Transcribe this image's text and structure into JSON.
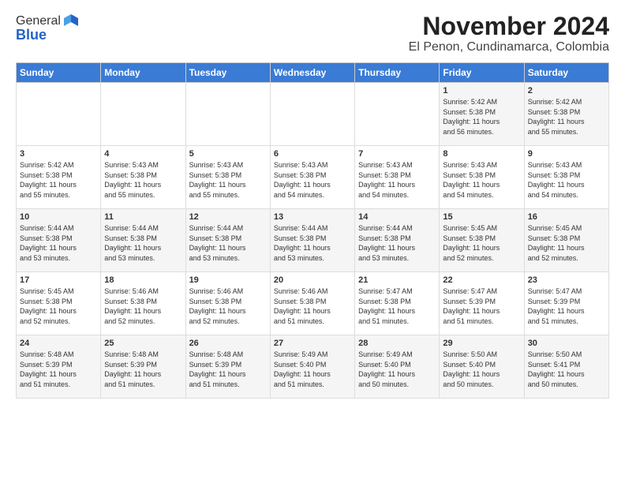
{
  "logo": {
    "general": "General",
    "blue": "Blue"
  },
  "title": "November 2024",
  "subtitle": "El Penon, Cundinamarca, Colombia",
  "headers": [
    "Sunday",
    "Monday",
    "Tuesday",
    "Wednesday",
    "Thursday",
    "Friday",
    "Saturday"
  ],
  "weeks": [
    [
      {
        "day": "",
        "info": ""
      },
      {
        "day": "",
        "info": ""
      },
      {
        "day": "",
        "info": ""
      },
      {
        "day": "",
        "info": ""
      },
      {
        "day": "",
        "info": ""
      },
      {
        "day": "1",
        "info": "Sunrise: 5:42 AM\nSunset: 5:38 PM\nDaylight: 11 hours\nand 56 minutes."
      },
      {
        "day": "2",
        "info": "Sunrise: 5:42 AM\nSunset: 5:38 PM\nDaylight: 11 hours\nand 55 minutes."
      }
    ],
    [
      {
        "day": "3",
        "info": "Sunrise: 5:42 AM\nSunset: 5:38 PM\nDaylight: 11 hours\nand 55 minutes."
      },
      {
        "day": "4",
        "info": "Sunrise: 5:43 AM\nSunset: 5:38 PM\nDaylight: 11 hours\nand 55 minutes."
      },
      {
        "day": "5",
        "info": "Sunrise: 5:43 AM\nSunset: 5:38 PM\nDaylight: 11 hours\nand 55 minutes."
      },
      {
        "day": "6",
        "info": "Sunrise: 5:43 AM\nSunset: 5:38 PM\nDaylight: 11 hours\nand 54 minutes."
      },
      {
        "day": "7",
        "info": "Sunrise: 5:43 AM\nSunset: 5:38 PM\nDaylight: 11 hours\nand 54 minutes."
      },
      {
        "day": "8",
        "info": "Sunrise: 5:43 AM\nSunset: 5:38 PM\nDaylight: 11 hours\nand 54 minutes."
      },
      {
        "day": "9",
        "info": "Sunrise: 5:43 AM\nSunset: 5:38 PM\nDaylight: 11 hours\nand 54 minutes."
      }
    ],
    [
      {
        "day": "10",
        "info": "Sunrise: 5:44 AM\nSunset: 5:38 PM\nDaylight: 11 hours\nand 53 minutes."
      },
      {
        "day": "11",
        "info": "Sunrise: 5:44 AM\nSunset: 5:38 PM\nDaylight: 11 hours\nand 53 minutes."
      },
      {
        "day": "12",
        "info": "Sunrise: 5:44 AM\nSunset: 5:38 PM\nDaylight: 11 hours\nand 53 minutes."
      },
      {
        "day": "13",
        "info": "Sunrise: 5:44 AM\nSunset: 5:38 PM\nDaylight: 11 hours\nand 53 minutes."
      },
      {
        "day": "14",
        "info": "Sunrise: 5:44 AM\nSunset: 5:38 PM\nDaylight: 11 hours\nand 53 minutes."
      },
      {
        "day": "15",
        "info": "Sunrise: 5:45 AM\nSunset: 5:38 PM\nDaylight: 11 hours\nand 52 minutes."
      },
      {
        "day": "16",
        "info": "Sunrise: 5:45 AM\nSunset: 5:38 PM\nDaylight: 11 hours\nand 52 minutes."
      }
    ],
    [
      {
        "day": "17",
        "info": "Sunrise: 5:45 AM\nSunset: 5:38 PM\nDaylight: 11 hours\nand 52 minutes."
      },
      {
        "day": "18",
        "info": "Sunrise: 5:46 AM\nSunset: 5:38 PM\nDaylight: 11 hours\nand 52 minutes."
      },
      {
        "day": "19",
        "info": "Sunrise: 5:46 AM\nSunset: 5:38 PM\nDaylight: 11 hours\nand 52 minutes."
      },
      {
        "day": "20",
        "info": "Sunrise: 5:46 AM\nSunset: 5:38 PM\nDaylight: 11 hours\nand 51 minutes."
      },
      {
        "day": "21",
        "info": "Sunrise: 5:47 AM\nSunset: 5:38 PM\nDaylight: 11 hours\nand 51 minutes."
      },
      {
        "day": "22",
        "info": "Sunrise: 5:47 AM\nSunset: 5:39 PM\nDaylight: 11 hours\nand 51 minutes."
      },
      {
        "day": "23",
        "info": "Sunrise: 5:47 AM\nSunset: 5:39 PM\nDaylight: 11 hours\nand 51 minutes."
      }
    ],
    [
      {
        "day": "24",
        "info": "Sunrise: 5:48 AM\nSunset: 5:39 PM\nDaylight: 11 hours\nand 51 minutes."
      },
      {
        "day": "25",
        "info": "Sunrise: 5:48 AM\nSunset: 5:39 PM\nDaylight: 11 hours\nand 51 minutes."
      },
      {
        "day": "26",
        "info": "Sunrise: 5:48 AM\nSunset: 5:39 PM\nDaylight: 11 hours\nand 51 minutes."
      },
      {
        "day": "27",
        "info": "Sunrise: 5:49 AM\nSunset: 5:40 PM\nDaylight: 11 hours\nand 51 minutes."
      },
      {
        "day": "28",
        "info": "Sunrise: 5:49 AM\nSunset: 5:40 PM\nDaylight: 11 hours\nand 50 minutes."
      },
      {
        "day": "29",
        "info": "Sunrise: 5:50 AM\nSunset: 5:40 PM\nDaylight: 11 hours\nand 50 minutes."
      },
      {
        "day": "30",
        "info": "Sunrise: 5:50 AM\nSunset: 5:41 PM\nDaylight: 11 hours\nand 50 minutes."
      }
    ]
  ]
}
